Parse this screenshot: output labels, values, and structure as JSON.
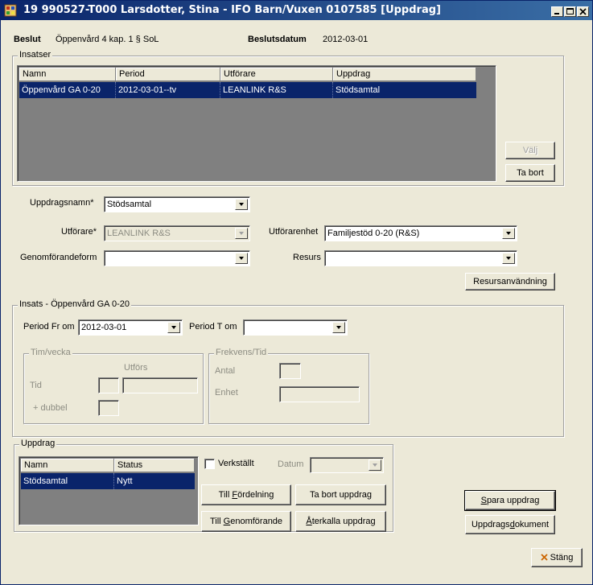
{
  "window": {
    "title": "19 990527-T000  Larsdotter, Stina   -   IFO Barn/Vuxen   0107585   [Uppdrag]"
  },
  "header": {
    "beslut_label": "Beslut",
    "beslut_value": "Öppenvård  4 kap. 1 § SoL",
    "beslutsdatum_label": "Beslutsdatum",
    "beslutsdatum_value": "2012-03-01"
  },
  "insatser": {
    "group_label": "Insatser",
    "columns": [
      "Namn",
      "Period",
      "Utförare",
      "Uppdrag"
    ],
    "rows": [
      [
        "Öppenvård GA 0-20",
        "2012-03-01--tv",
        "LEANLINK R&S",
        "Stödsamtal"
      ]
    ],
    "valj_label": "Välj",
    "ta_bort_label": "Ta bort"
  },
  "form": {
    "uppdragsnamn_label": "Uppdragsnamn*",
    "uppdragsnamn_value": "Stödsamtal",
    "utforare_label": "Utförare*",
    "utforare_value": "LEANLINK R&S",
    "utforarenhet_label": "Utförarenhet",
    "utforarenhet_value": "Familjestöd 0-20 (R&S)",
    "genomforandeform_label": "Genomförandeform",
    "genomforandeform_value": "",
    "resurs_label": "Resurs",
    "resurs_value": "",
    "resursanvandning_label": "Resursanvändning"
  },
  "insats": {
    "group_label": "Insats - Öppenvård GA 0-20",
    "period_from_label": "Period Fr om",
    "period_from_value": "2012-03-01",
    "period_to_label": "Period T om",
    "period_to_value": "",
    "tim_group_label": "Tim/vecka",
    "utfors_label": "Utförs",
    "tid_label": "Tid",
    "dubbel_label": "+ dubbel",
    "frekvens_group_label": "Frekvens/Tid",
    "antal_label": "Antal",
    "enhet_label": "Enhet"
  },
  "uppdrag": {
    "group_label": "Uppdrag",
    "columns": [
      "Namn",
      "Status"
    ],
    "rows": [
      [
        "Stödsamtal",
        "Nytt"
      ]
    ],
    "verkstallt_label": "Verkställt",
    "datum_label": "Datum",
    "till_fordelning_pre": "Till ",
    "till_fordelning_u": "F",
    "till_fordelning_post": "ördelning",
    "ta_bort_uppdrag_label": "Ta bort uppdrag",
    "till_genomforande_pre": "Till ",
    "till_genomforande_u": "G",
    "till_genomforande_post": "enomförande",
    "aterkalla_pre": "",
    "aterkalla_u": "Å",
    "aterkalla_post": "terkalla uppdrag"
  },
  "actions": {
    "spara_u": "S",
    "spara_post": "para uppdrag",
    "dokument_pre": "Uppdrags",
    "dokument_u": "d",
    "dokument_post": "okument",
    "stang_label": "Stäng"
  },
  "colors": {
    "selection": "#0a246a",
    "title_gradient_start": "#0a246a",
    "title_gradient_end": "#3a6ea5",
    "window_bg": "#ece9d8",
    "grid_bg": "#808080",
    "close_icon_color": "#cc6600"
  },
  "icons": [
    "app-icon",
    "minimize-icon",
    "maximize-icon",
    "close-icon",
    "dropdown-arrow-icon",
    "stang-x-icon"
  ]
}
